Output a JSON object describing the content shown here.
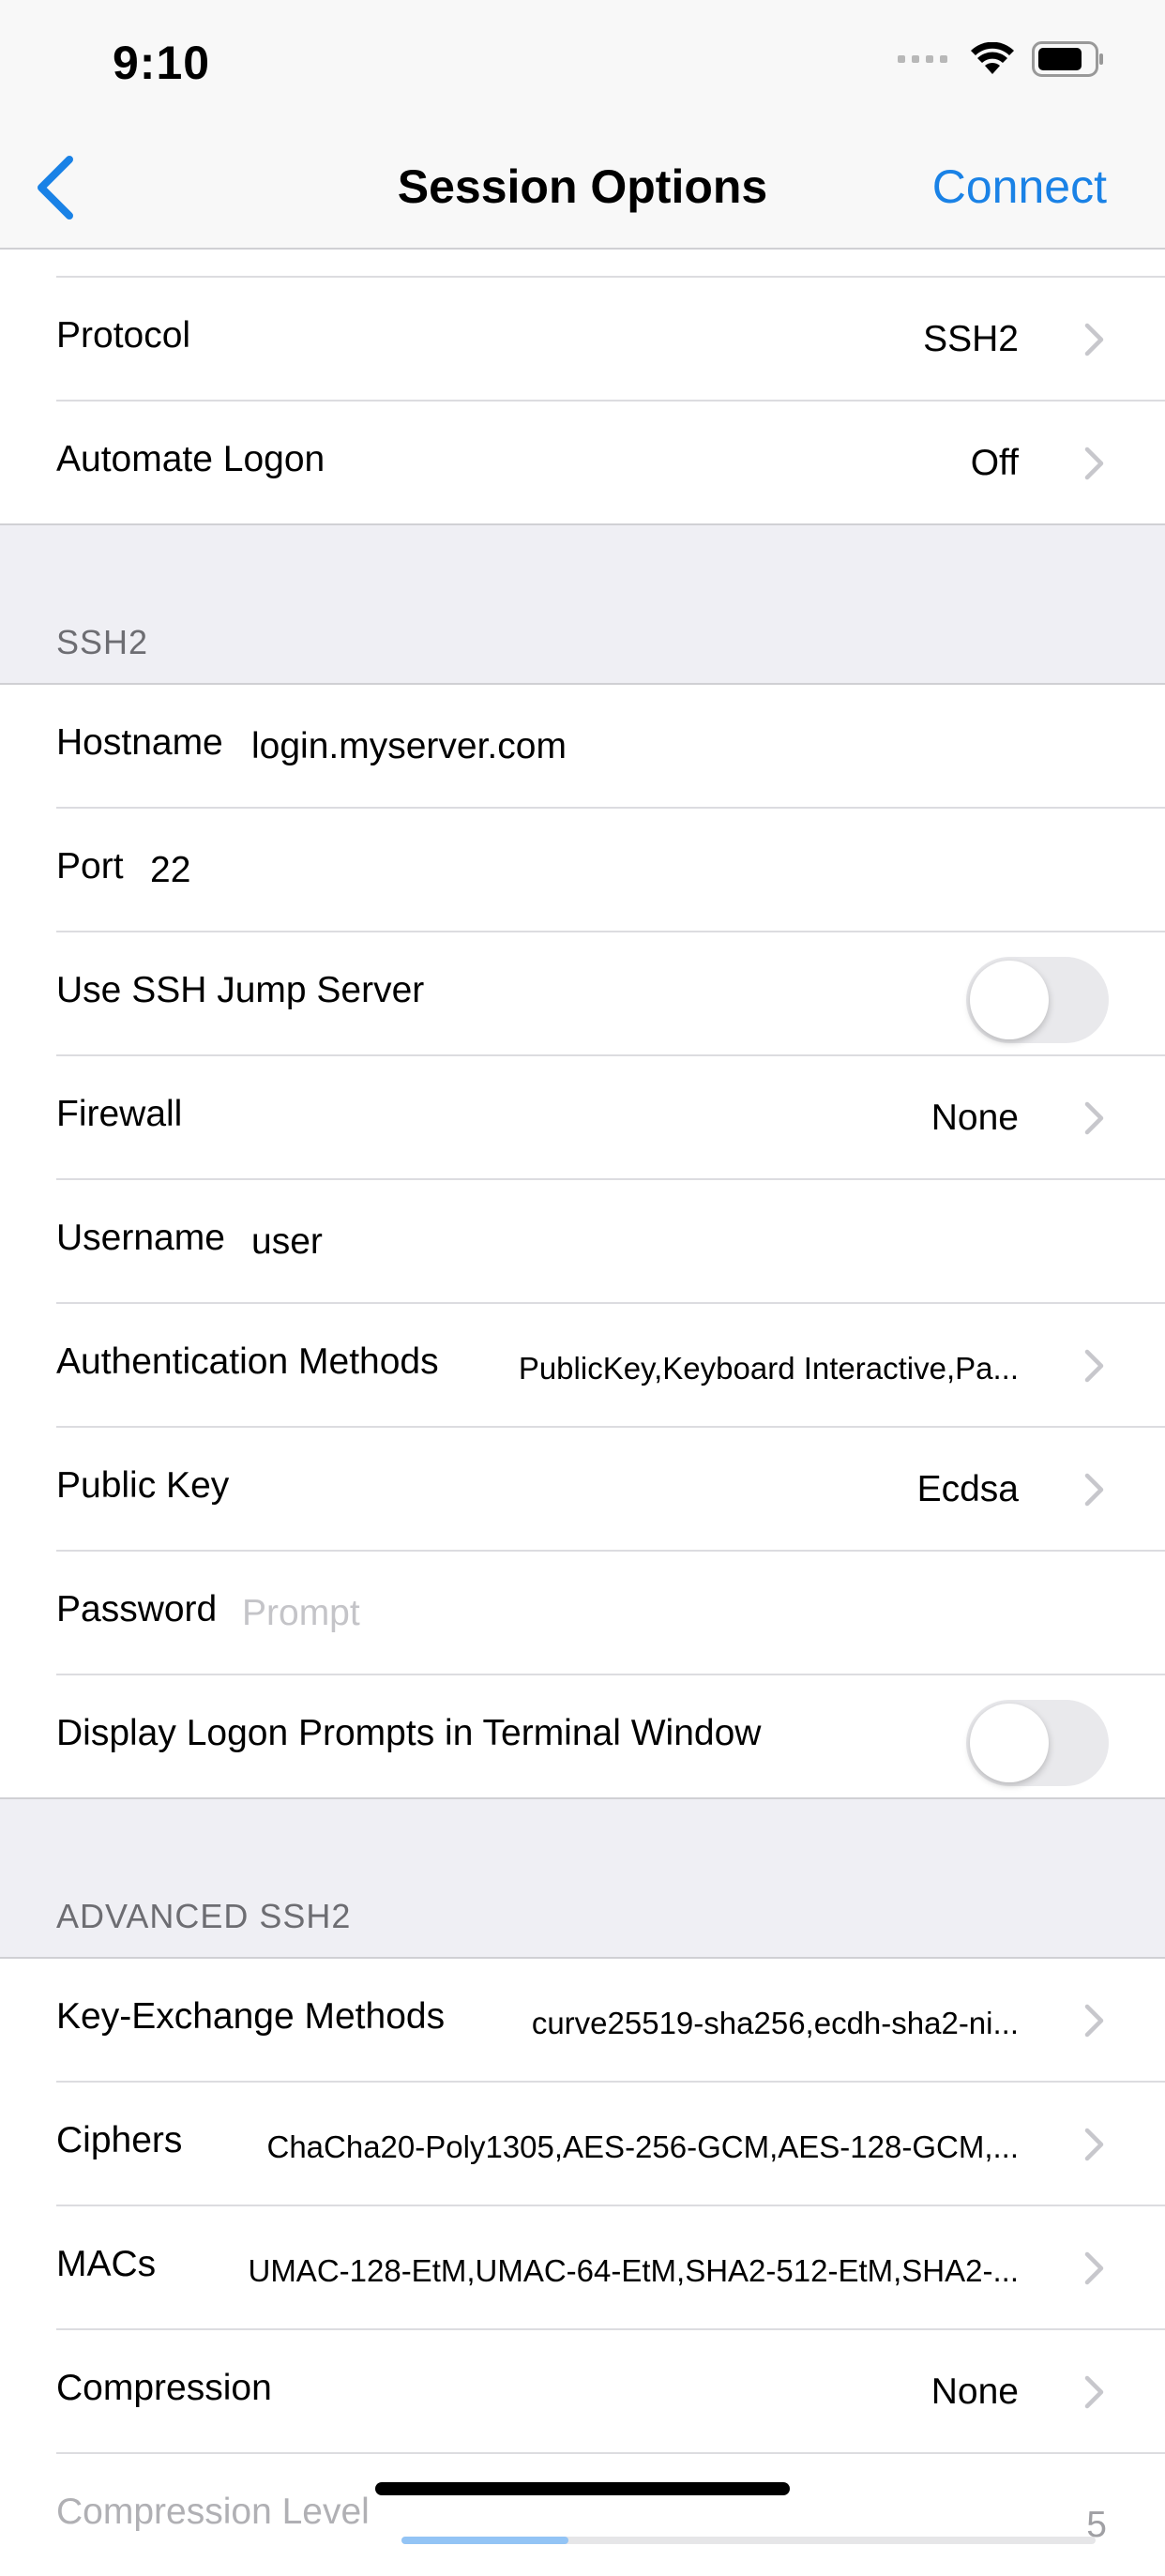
{
  "status_bar": {
    "time": "9:10"
  },
  "nav": {
    "title": "Session Options",
    "connect_label": "Connect",
    "accent_color": "#1a82e6"
  },
  "top_rows": [
    {
      "label": "Protocol",
      "value": "SSH2"
    },
    {
      "label": "Automate Logon",
      "value": "Off"
    }
  ],
  "ssh2": {
    "header": "SSH2",
    "hostname": {
      "label": "Hostname",
      "value": "login.myserver.com"
    },
    "port": {
      "label": "Port",
      "value": "22"
    },
    "jump_server": {
      "label": "Use SSH Jump Server",
      "on": false
    },
    "firewall": {
      "label": "Firewall",
      "value": "None"
    },
    "username": {
      "label": "Username",
      "value": "user"
    },
    "auth_methods": {
      "label": "Authentication Methods",
      "value": "PublicKey,Keyboard Interactive,Pa..."
    },
    "public_key": {
      "label": "Public Key",
      "value": "Ecdsa"
    },
    "password": {
      "label": "Password",
      "placeholder": "Prompt"
    },
    "logon_prompts": {
      "label": "Display Logon Prompts in Terminal Window",
      "on": false
    }
  },
  "advanced": {
    "header": "ADVANCED SSH2",
    "kex": {
      "label": "Key-Exchange Methods",
      "value": "curve25519-sha256,ecdh-sha2-ni..."
    },
    "ciphers": {
      "label": "Ciphers",
      "value": "ChaCha20-Poly1305,AES-256-GCM,AES-128-GCM,..."
    },
    "macs": {
      "label": "MACs",
      "value": "UMAC-128-EtM,UMAC-64-EtM,SHA2-512-EtM,SHA2-..."
    },
    "compression": {
      "label": "Compression",
      "value": "None"
    },
    "compression_level": {
      "label": "Compression Level",
      "value": "5",
      "slider_fraction": 0.24
    }
  }
}
